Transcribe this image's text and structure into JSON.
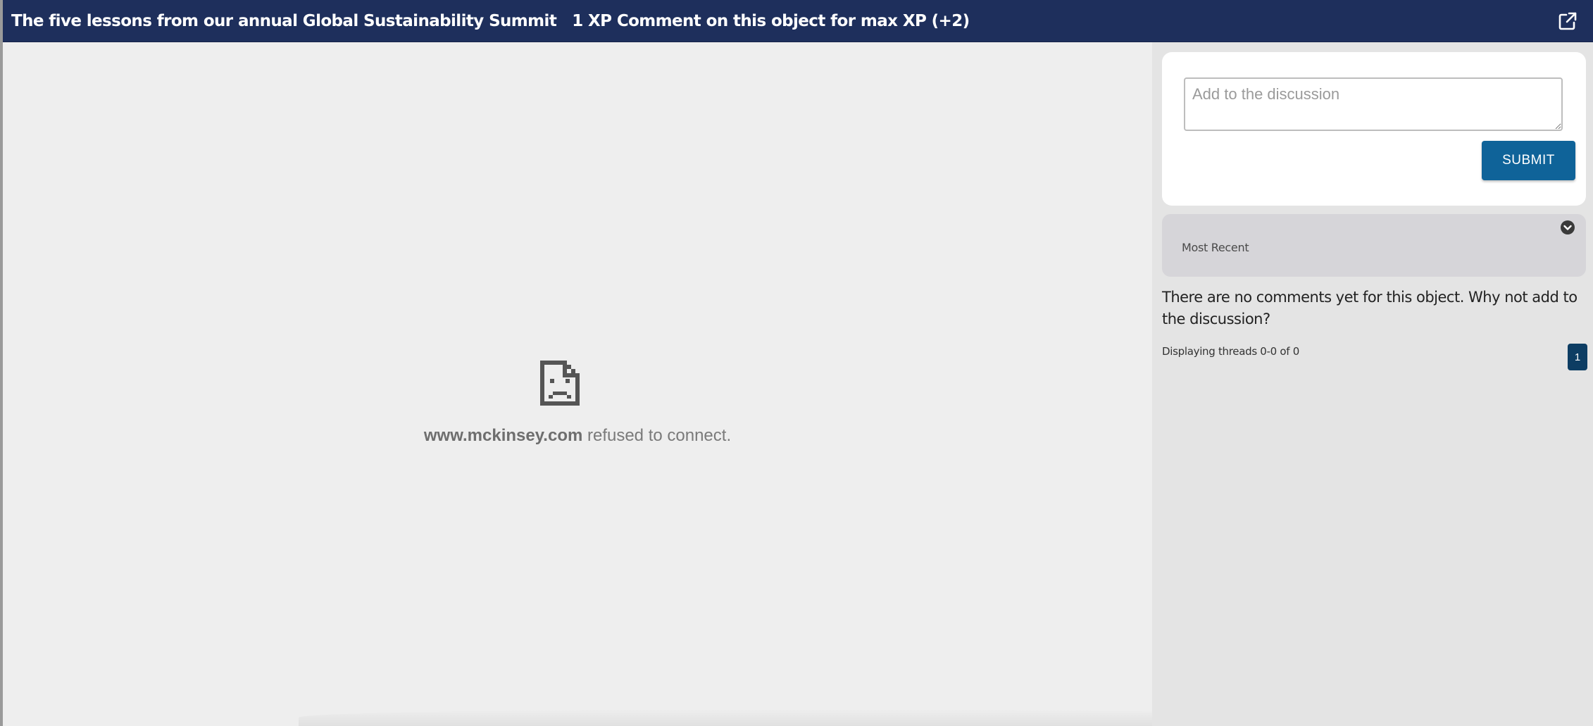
{
  "header": {
    "title": "The five lessons from our annual Global Sustainability Summit",
    "xp_text": "1 XP Comment on this object for max XP (+2)",
    "external_icon": "external-link-icon"
  },
  "embed": {
    "error_icon": "sad-document-icon",
    "domain": "www.mckinsey.com",
    "message": " refused to connect."
  },
  "discussion": {
    "placeholder": "Add to the discussion",
    "submit_label": "SUBMIT",
    "sort_label": "Most Recent",
    "sort_icon": "chevron-down-circle-icon",
    "empty_message": "There are no comments yet for this object. Why not add to the discussion?",
    "threads_label": "Displaying threads 0-0 of 0",
    "pages": [
      "1"
    ]
  },
  "colors": {
    "header_bg": "#1e2f5c",
    "submit_bg": "#0f6399",
    "page_active_bg": "#0d3d63",
    "sort_bar_bg": "#d6d5d9"
  }
}
